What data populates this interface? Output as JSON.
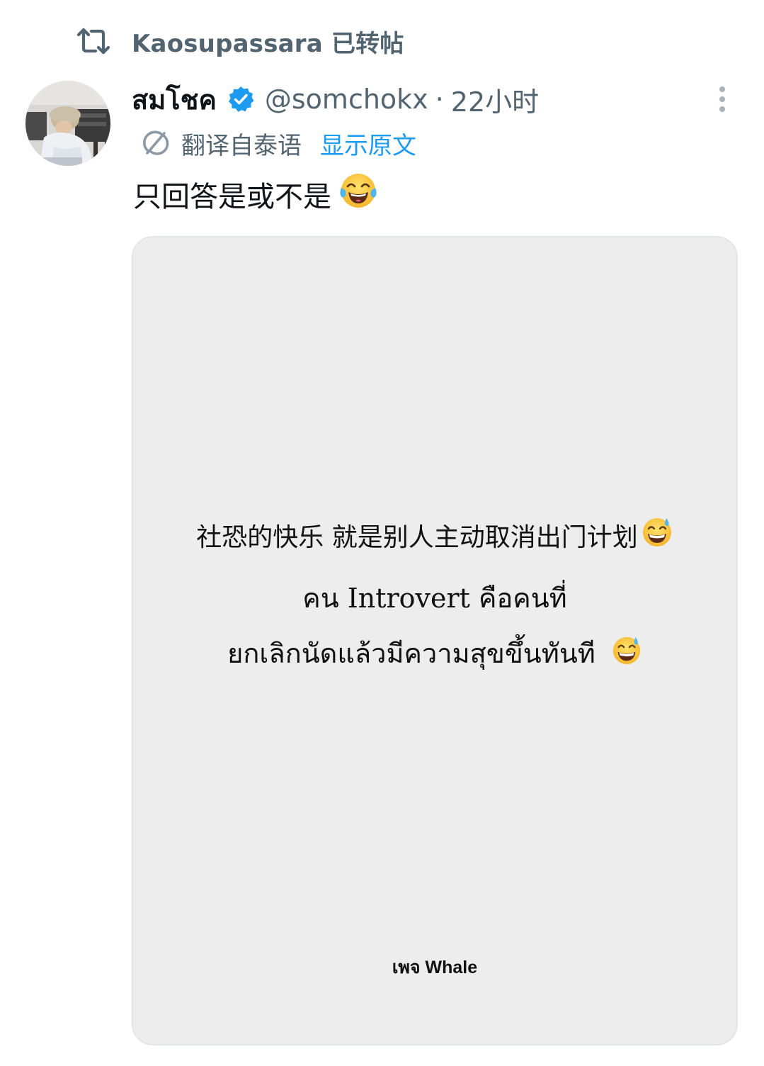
{
  "repost": {
    "icon": "repost-icon",
    "text": "Kaosupassara 已转帖"
  },
  "post": {
    "display_name": "สมโชค",
    "verified_icon": "verified-badge-icon",
    "handle": "@somchokx",
    "separator": "·",
    "time": "22小时",
    "more_icon": "more-vertical-icon",
    "translation": {
      "icon": "translate-icon",
      "label": "翻译自泰语",
      "show_original": "显示原文"
    },
    "text": "只回答是或不是",
    "text_emoji": "face-with-tears-of-joy",
    "colors": {
      "link": "#1d9bf0",
      "secondary_text": "#536471",
      "verified": "#1d9bf0"
    }
  },
  "media": {
    "line_cn": "社恐的快乐 就是别人主动取消出门计划",
    "line_th_1": "คน Introvert คือคนที่",
    "line_th_2": "ยกเลิกนัดแล้วมีความสุขขึ้นทันที",
    "emoji": "grinning-face-with-sweat",
    "credit": "เพจ Whale",
    "background": "#ededed"
  }
}
